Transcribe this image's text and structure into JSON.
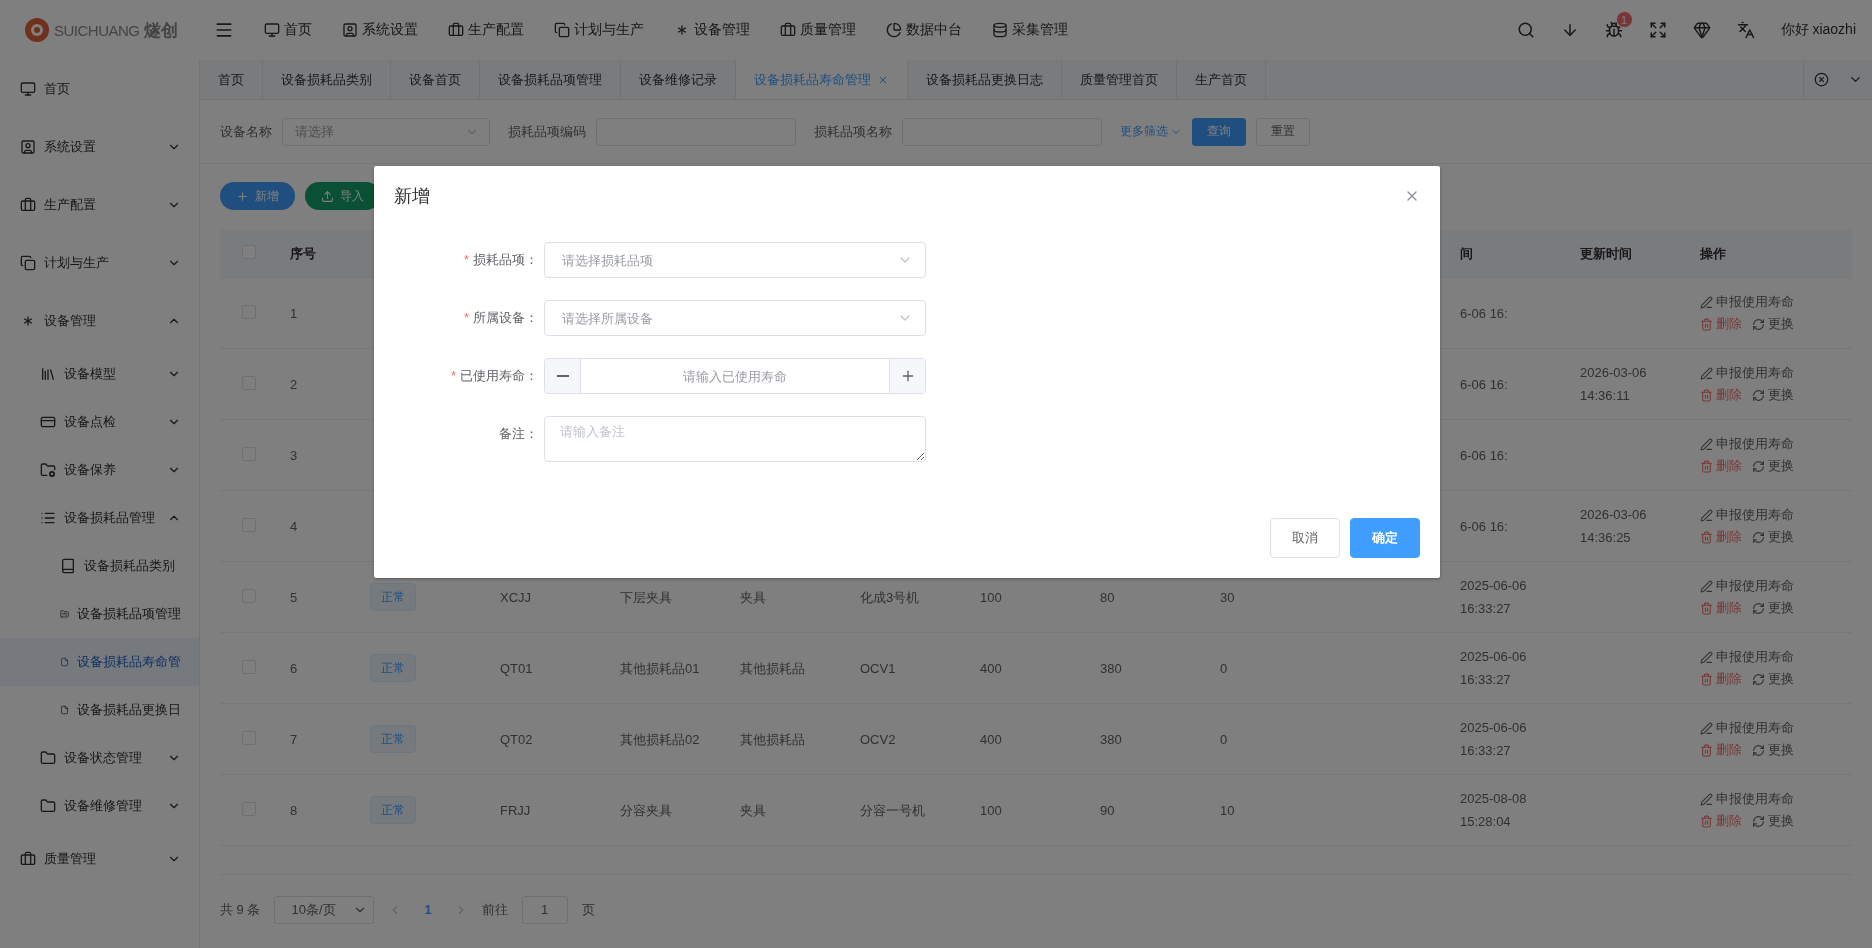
{
  "header": {
    "logo": {
      "latin": "SUICHUANG",
      "chinese": "燧创"
    },
    "nav": [
      {
        "label": "首页"
      },
      {
        "label": "系统设置"
      },
      {
        "label": "生产配置"
      },
      {
        "label": "计划与生产"
      },
      {
        "label": "设备管理"
      },
      {
        "label": "质量管理"
      },
      {
        "label": "数据中台"
      },
      {
        "label": "采集管理"
      }
    ],
    "badge": "1",
    "user": "你好 xiaozhi"
  },
  "tabs": [
    {
      "label": "首页",
      "selected": false
    },
    {
      "label": "设备损耗品类别",
      "selected": false
    },
    {
      "label": "设备首页",
      "selected": false
    },
    {
      "label": "设备损耗品项管理",
      "selected": false
    },
    {
      "label": "设备维修记录",
      "selected": false
    },
    {
      "label": "设备损耗品寿命管理",
      "selected": true
    },
    {
      "label": "设备损耗品更换日志",
      "selected": false
    },
    {
      "label": "质量管理首页",
      "selected": false
    },
    {
      "label": "生产首页",
      "selected": false
    }
  ],
  "sidebar": {
    "items": [
      {
        "label": "首页",
        "selected": false
      },
      {
        "label": "系统设置",
        "selected": false,
        "expanded": false
      },
      {
        "label": "生产配置",
        "selected": false,
        "expanded": false
      },
      {
        "label": "计划与生产",
        "selected": false,
        "expanded": false
      },
      {
        "label": "设备管理",
        "selected": false,
        "expanded": true,
        "children": [
          {
            "label": "设备模型",
            "selected": false,
            "expanded": false
          },
          {
            "label": "设备点检",
            "selected": false,
            "expanded": false
          },
          {
            "label": "设备保养",
            "selected": false,
            "expanded": false
          },
          {
            "label": "设备损耗品管理",
            "selected": false,
            "expanded": true,
            "children": [
              {
                "label": "设备损耗品类别",
                "selected": false
              },
              {
                "label": "设备损耗品项管理",
                "selected": false
              },
              {
                "label": "设备损耗品寿命管",
                "selected": true
              },
              {
                "label": "设备损耗品更换日",
                "selected": false
              }
            ]
          },
          {
            "label": "设备状态管理",
            "selected": false,
            "expanded": false
          },
          {
            "label": "设备维修管理",
            "selected": false,
            "expanded": false
          }
        ]
      },
      {
        "label": "质量管理",
        "selected": false,
        "expanded": false
      }
    ]
  },
  "filters": {
    "fields": [
      {
        "label": "设备名称",
        "kind": "select",
        "placeholder": "请选择"
      },
      {
        "label": "损耗品项编码",
        "kind": "input"
      },
      {
        "label": "损耗品项名称",
        "kind": "input"
      }
    ],
    "more": "更多筛选",
    "buttons": [
      {
        "label": "查询",
        "kind": "primary"
      },
      {
        "label": "重置",
        "kind": "plain"
      }
    ]
  },
  "toolbar": [
    {
      "label": "新增",
      "kind": "add"
    },
    {
      "label": "导入",
      "kind": "import"
    }
  ],
  "table": {
    "header_checked": false,
    "columns": [
      {
        "kind": "text",
        "label": "序号"
      },
      {
        "kind": "tag"
      },
      {
        "kind": "text"
      },
      {
        "kind": "text"
      },
      {
        "kind": "text"
      },
      {
        "kind": "text"
      },
      {
        "kind": "text"
      },
      {
        "kind": "text"
      },
      {
        "kind": "text"
      },
      {
        "kind": "text",
        "label": "间"
      },
      {
        "kind": "text",
        "label": "更新时间"
      },
      {
        "kind": "actions",
        "label": "操作"
      }
    ],
    "rows": [
      {
        "checked": false,
        "cells": [
          "1",
          null,
          null,
          null,
          null,
          null,
          null,
          null,
          null,
          "6-06 16:",
          null,
          [
            {
              "kind": "report",
              "label": "申报使用寿命"
            },
            {
              "kind": "delete",
              "label": "删除"
            },
            {
              "kind": "replace",
              "label": "更换"
            }
          ]
        ]
      },
      {
        "checked": false,
        "cells": [
          "2",
          null,
          null,
          null,
          null,
          null,
          null,
          null,
          null,
          "6-06 16:",
          "2026-03-06 14:36:11",
          [
            {
              "kind": "report",
              "label": "申报使用寿命"
            },
            {
              "kind": "delete",
              "label": "删除"
            },
            {
              "kind": "replace",
              "label": "更换"
            }
          ]
        ]
      },
      {
        "checked": false,
        "cells": [
          "3",
          null,
          null,
          null,
          null,
          null,
          null,
          null,
          null,
          "6-06 16:",
          null,
          [
            {
              "kind": "report",
              "label": "申报使用寿命"
            },
            {
              "kind": "delete",
              "label": "删除"
            },
            {
              "kind": "replace",
              "label": "更换"
            }
          ]
        ]
      },
      {
        "checked": false,
        "cells": [
          "4",
          null,
          null,
          null,
          null,
          null,
          null,
          null,
          null,
          "6-06 16:",
          "2026-03-06 14:36:25",
          [
            {
              "kind": "report",
              "label": "申报使用寿命"
            },
            {
              "kind": "delete",
              "label": "删除"
            },
            {
              "kind": "replace",
              "label": "更换"
            }
          ]
        ]
      },
      {
        "checked": false,
        "cells": [
          "5",
          "正常",
          "XCJJ",
          "下层夹具",
          "夹具",
          "化成3号机",
          "100",
          "80",
          "30",
          "2025-06-06 16:33:27",
          null,
          [
            {
              "kind": "report",
              "label": "申报使用寿命"
            },
            {
              "kind": "delete",
              "label": "删除"
            },
            {
              "kind": "replace",
              "label": "更换"
            }
          ]
        ]
      },
      {
        "checked": false,
        "cells": [
          "6",
          "正常",
          "QT01",
          "其他损耗品01",
          "其他损耗品",
          "OCV1",
          "400",
          "380",
          "0",
          "2025-06-06 16:33:27",
          null,
          [
            {
              "kind": "report",
              "label": "申报使用寿命"
            },
            {
              "kind": "delete",
              "label": "删除"
            },
            {
              "kind": "replace",
              "label": "更换"
            }
          ]
        ]
      },
      {
        "checked": false,
        "cells": [
          "7",
          "正常",
          "QT02",
          "其他损耗品02",
          "其他损耗品",
          "OCV2",
          "400",
          "380",
          "0",
          "2025-06-06 16:33:27",
          null,
          [
            {
              "kind": "report",
              "label": "申报使用寿命"
            },
            {
              "kind": "delete",
              "label": "删除"
            },
            {
              "kind": "replace",
              "label": "更换"
            }
          ]
        ]
      },
      {
        "checked": false,
        "cells": [
          "8",
          "正常",
          "FRJJ",
          "分容夹具",
          "夹具",
          "分容一号机",
          "100",
          "90",
          "10",
          "2025-08-08 15:28:04",
          null,
          [
            {
              "kind": "report",
              "label": "申报使用寿命"
            },
            {
              "kind": "delete",
              "label": "删除"
            },
            {
              "kind": "replace",
              "label": "更换"
            }
          ]
        ]
      }
    ]
  },
  "pagination": {
    "total": "共 9 条",
    "page_size": "10条/页",
    "pages": [
      {
        "label": "1",
        "selected": true
      }
    ],
    "goto_label": "前往",
    "goto_value": "1",
    "goto_suffix": "页"
  },
  "dialog": {
    "title": "新增",
    "fields": [
      {
        "label": "损耗品项：",
        "required_mark": "*",
        "kind": "select",
        "placeholder": "请选择损耗品项"
      },
      {
        "label": "所属设备：",
        "required_mark": "*",
        "kind": "select",
        "placeholder": "请选择所属设备"
      },
      {
        "label": "已使用寿命：",
        "required_mark": "*",
        "kind": "number",
        "placeholder": "请输入已使用寿命"
      },
      {
        "label": "备注：",
        "kind": "textarea",
        "placeholder": "请输入备注"
      }
    ],
    "buttons": [
      {
        "label": "取消",
        "kind": "plain"
      },
      {
        "label": "确定",
        "kind": "primary"
      }
    ]
  }
}
